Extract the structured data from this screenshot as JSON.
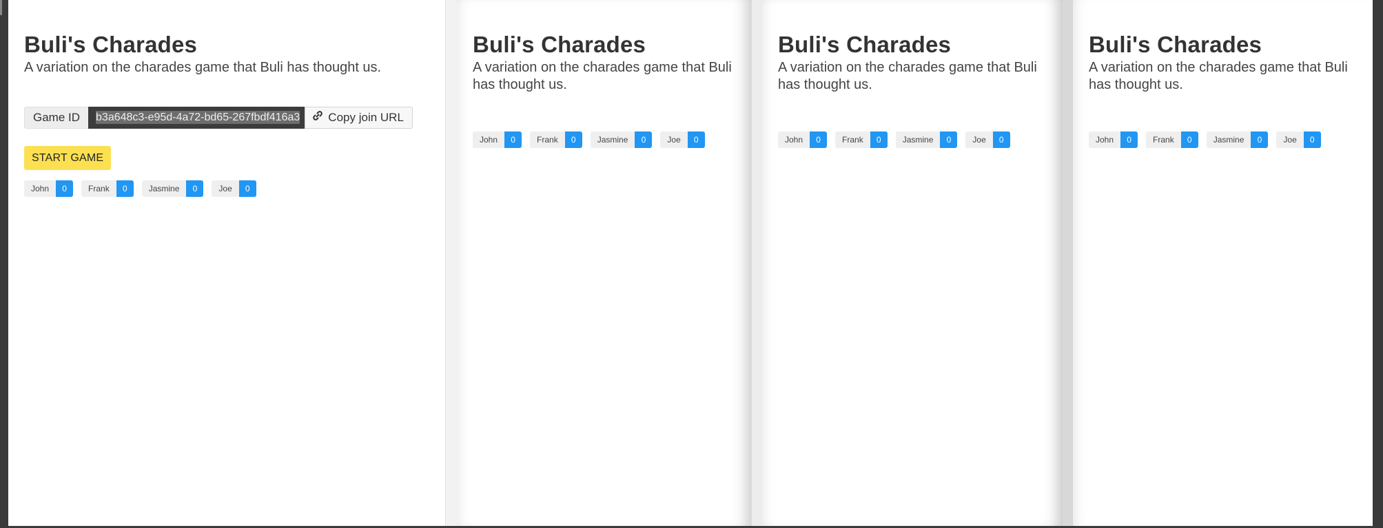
{
  "app": {
    "title": "Buli's Charades",
    "subtitle": "A variation on the charades game that Buli has thought us."
  },
  "host": {
    "game_id_label": "Game ID",
    "game_id": "b3a648c3-e95d-4a72-bd65-267fbdf416a3",
    "copy_label": "Copy join URL",
    "start_label": "START GAME"
  },
  "players": [
    {
      "name": "John",
      "score": "0"
    },
    {
      "name": "Frank",
      "score": "0"
    },
    {
      "name": "Jasmine",
      "score": "0"
    },
    {
      "name": "Joe",
      "score": "0"
    }
  ],
  "colors": {
    "start_button": "#fde052",
    "score_badge": "#2196f3",
    "game_id_bg": "#3c3c3c"
  },
  "icons": {
    "copy": "link-icon"
  }
}
